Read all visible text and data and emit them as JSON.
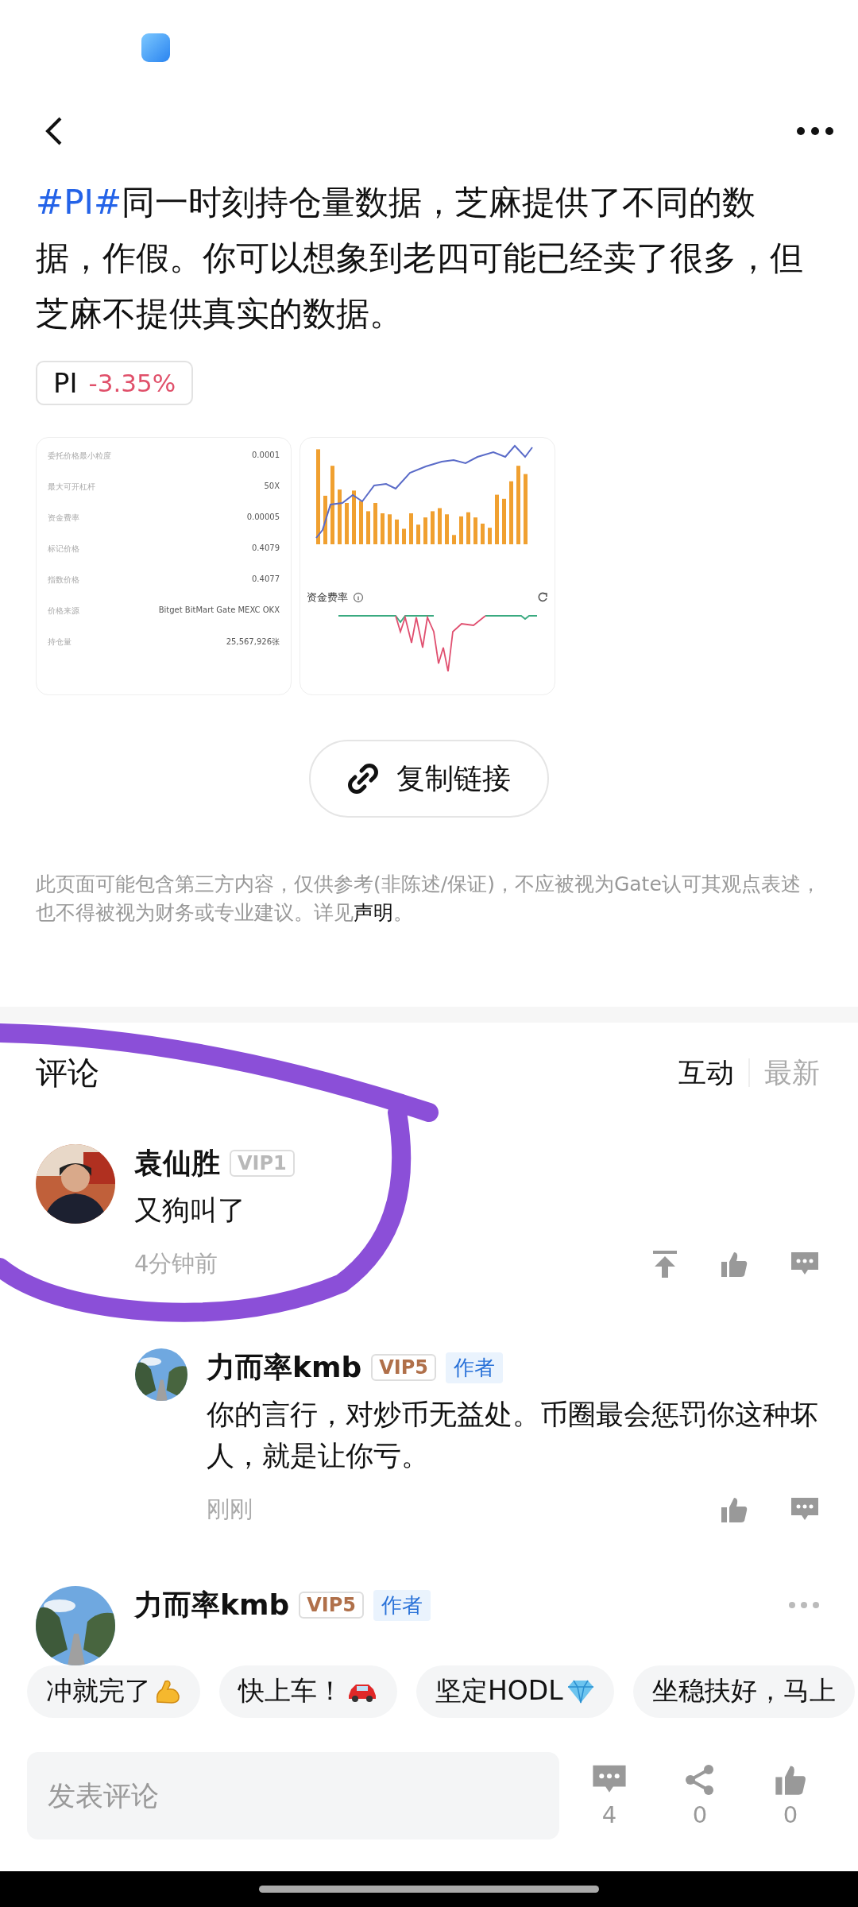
{
  "post": {
    "hashtag": "#PI#",
    "text": "同一时刻持仓量数据，芝麻提供了不同的数据，作假。你可以想象到老四可能已经卖了很多，但芝麻不提供真实的数据。"
  },
  "ticker": {
    "symbol": "PI",
    "change": "-3.35%"
  },
  "screenshot_table": [
    {
      "label": "委托价格最小粒度",
      "value": "0.0001"
    },
    {
      "label": "最大可开杠杆",
      "value": "50X"
    },
    {
      "label": "资金费率",
      "value": "0.00005"
    },
    {
      "label": "标记价格",
      "value": "0.4079"
    },
    {
      "label": "指数价格",
      "value": "0.4077"
    },
    {
      "label": "价格来源",
      "value": "Bitget BitMart Gate MEXC OKX"
    },
    {
      "label": "持仓量",
      "value": "25,567,926张"
    }
  ],
  "screenshot_chart": {
    "funding_title": "资金费率"
  },
  "copy_button": "复制链接",
  "disclaimer": {
    "text": "此页面可能包含第三方内容，仅供参考(非陈述/保证)，不应被视为Gate认可其观点表述，也不得被视为财务或专业建议。详见",
    "link": "声明",
    "end": "。"
  },
  "comments_header": {
    "title": "评论",
    "tabs": [
      {
        "label": "互动",
        "selected": true
      },
      {
        "label": "最新",
        "selected": false
      }
    ]
  },
  "comments": [
    {
      "name": "袁仙胜",
      "badge": {
        "text": "VIP1",
        "kind": "silver"
      },
      "text": "又狗叫了",
      "time": "4分钟前",
      "reply": false,
      "avatar": {
        "kind": "portrait"
      },
      "actions": [
        {
          "kind": "pin"
        },
        {
          "kind": "like"
        },
        {
          "kind": "comment"
        }
      ]
    },
    {
      "name": "力而率kmb",
      "badge": {
        "text": "VIP5",
        "kind": "bronze"
      },
      "author_label": "作者",
      "text": "你的言行，对炒币无益处。币圈最会惩罚你这种坏人，就是让你亏。",
      "time": "刚刚",
      "reply": true,
      "avatar": {
        "kind": "road"
      },
      "actions": [
        {
          "kind": "like"
        },
        {
          "kind": "comment"
        }
      ]
    },
    {
      "name": "力而率kmb",
      "badge": {
        "text": "VIP5",
        "kind": "bronze"
      },
      "author_label": "作者",
      "reply": false,
      "avatar": {
        "kind": "road"
      },
      "more": true
    }
  ],
  "quick_replies": [
    {
      "text": "冲就完了",
      "kind": "muscle"
    },
    {
      "text": "快上车！",
      "kind": "car"
    },
    {
      "text": "坚定HODL",
      "kind": "diamond"
    },
    {
      "text": "坐稳扶好，马上",
      "kind": "plain"
    }
  ],
  "composer": {
    "placeholder": "发表评论",
    "counts": [
      {
        "kind": "comment",
        "count": "4"
      },
      {
        "kind": "share",
        "count": "0"
      },
      {
        "kind": "like",
        "count": "0"
      }
    ]
  }
}
